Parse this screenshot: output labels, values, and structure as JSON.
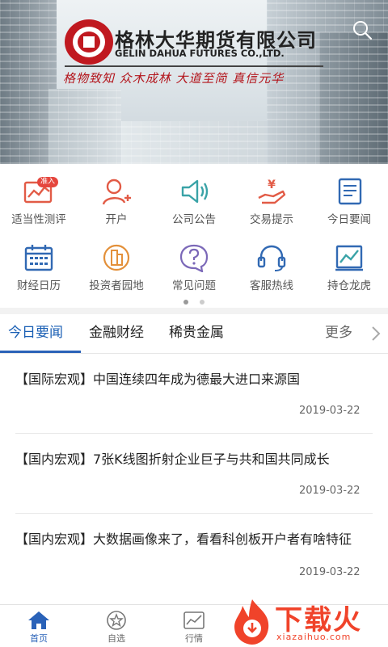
{
  "banner": {
    "company_cn": "格林大华期货有限公司",
    "company_en": "GELIN DAHUA FUTURES CO.,LTD.",
    "slogan": "格物致知  众木成林  大道至简  真信元华",
    "search_icon": "search-icon"
  },
  "menu": [
    {
      "label": "适当性测评",
      "icon": "chart-monitor-icon",
      "badge": "准入"
    },
    {
      "label": "开户",
      "icon": "user-add-icon"
    },
    {
      "label": "公司公告",
      "icon": "speaker-icon"
    },
    {
      "label": "交易提示",
      "icon": "yen-hand-icon"
    },
    {
      "label": "今日要闻",
      "icon": "document-icon"
    },
    {
      "label": "财经日历",
      "icon": "calendar-icon"
    },
    {
      "label": "投资者园地",
      "icon": "buildings-icon"
    },
    {
      "label": "常见问题",
      "icon": "question-icon"
    },
    {
      "label": "客服热线",
      "icon": "headset-icon"
    },
    {
      "label": "持仓龙虎",
      "icon": "chart-board-icon"
    }
  ],
  "pager": {
    "pages": 2,
    "current": 1
  },
  "tabs": {
    "items": [
      "今日要闻",
      "金融财经",
      "稀贵金属"
    ],
    "active": 0,
    "more_label": "更多"
  },
  "news": [
    {
      "title": "【国际宏观】中国连续四年成为德最大进口来源国",
      "date": "2019-03-22"
    },
    {
      "title": "【国内宏观】7张K线图折射企业巨子与共和国共同成长",
      "date": "2019-03-22"
    },
    {
      "title": "【国内宏观】大数据画像来了，看看科创板开户者有啥特征",
      "date": "2019-03-22"
    }
  ],
  "bottom_nav": [
    {
      "label": "首页",
      "icon": "home-icon"
    },
    {
      "label": "自选",
      "icon": "star-icon"
    },
    {
      "label": "行情",
      "icon": "market-chart-icon"
    }
  ],
  "watermark": {
    "text": "下载火",
    "url": "xiazaihuo.com"
  },
  "colors": {
    "accent": "#2a62b8",
    "brand_red": "#c01920",
    "icon_orange": "#e25b46",
    "icon_teal": "#3aa3a7",
    "icon_blue": "#3169b3"
  }
}
